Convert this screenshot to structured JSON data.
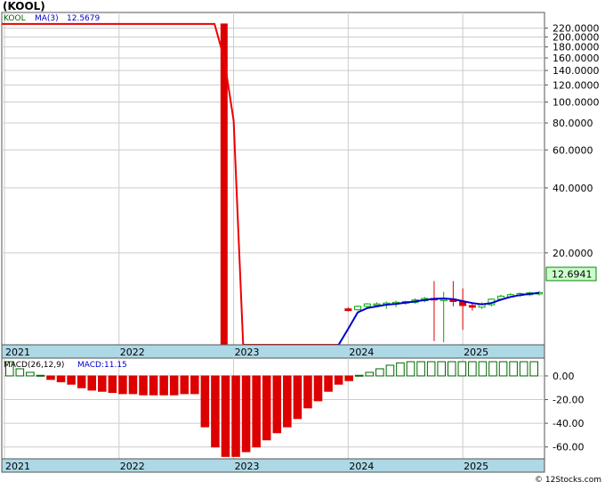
{
  "ticker_label": "(KOOL)",
  "legend": {
    "symbol": "KOOL",
    "ma_label": "MA(3)",
    "ma_value": "12.5679",
    "macd_label": "MACD(26,12,9)",
    "macd_name": "MACD:",
    "macd_value": "11.15"
  },
  "last_price": "12.6941",
  "footer": "© 12Stocks.com",
  "colors": {
    "up": "#00aa00",
    "down": "#dd0000",
    "ma": "#0000cc",
    "ma_red": "#ee0000",
    "axis_band": "#add8e6",
    "price_tag_bg": "#ccffcc"
  },
  "chart_data": [
    {
      "type": "candlestick",
      "title": "(KOOL)",
      "y_scale": "log",
      "y_ticks": [
        "220.0000",
        "200.0000",
        "180.0000",
        "160.0000",
        "140.0000",
        "120.0000",
        "100.0000",
        "80.0000",
        "60.0000",
        "40.0000",
        "20.0000"
      ],
      "y_tick_values": [
        220,
        200,
        180,
        160,
        140,
        120,
        100,
        80,
        60,
        40,
        20
      ],
      "x_ticks": [
        "2021",
        "2022",
        "2023",
        "2024",
        "2025"
      ],
      "x_tick_dates": [
        "2021-01",
        "2022-01",
        "2023-01",
        "2024-01",
        "2025-01"
      ],
      "ylim": [
        7.5,
        260
      ],
      "xlim": [
        "2021-01",
        "2025-09"
      ],
      "candles": [
        {
          "date": "2022-12",
          "open": 230,
          "high": 230,
          "low": 7.5,
          "close": 7.5,
          "dir": "down"
        },
        {
          "date": "2024-01",
          "open": 11.0,
          "high": 11.2,
          "low": 10.7,
          "close": 10.8,
          "dir": "down"
        },
        {
          "date": "2024-02",
          "open": 10.9,
          "high": 11.4,
          "low": 10.8,
          "close": 11.3,
          "dir": "up"
        },
        {
          "date": "2024-03",
          "open": 11.3,
          "high": 11.7,
          "low": 11.1,
          "close": 11.6,
          "dir": "up"
        },
        {
          "date": "2024-04",
          "open": 11.5,
          "high": 11.8,
          "low": 11.3,
          "close": 11.6,
          "dir": "up"
        },
        {
          "date": "2024-05",
          "open": 11.5,
          "high": 11.9,
          "low": 11.0,
          "close": 11.7,
          "dir": "up"
        },
        {
          "date": "2024-06",
          "open": 11.6,
          "high": 12.0,
          "low": 11.2,
          "close": 11.8,
          "dir": "up"
        },
        {
          "date": "2024-07",
          "open": 11.7,
          "high": 12.0,
          "low": 11.5,
          "close": 11.9,
          "dir": "up"
        },
        {
          "date": "2024-08",
          "open": 11.8,
          "high": 12.3,
          "low": 11.6,
          "close": 12.1,
          "dir": "up"
        },
        {
          "date": "2024-09",
          "open": 12.0,
          "high": 12.5,
          "low": 11.8,
          "close": 12.3,
          "dir": "up"
        },
        {
          "date": "2024-10",
          "open": 12.3,
          "high": 14.8,
          "low": 7.8,
          "close": 12.1,
          "dir": "down"
        },
        {
          "date": "2024-11",
          "open": 12.1,
          "high": 13.2,
          "low": 7.7,
          "close": 12.2,
          "dir": "up"
        },
        {
          "date": "2024-12",
          "open": 12.2,
          "high": 14.8,
          "low": 11.3,
          "close": 11.9,
          "dir": "down"
        },
        {
          "date": "2025-01",
          "open": 11.9,
          "high": 13.7,
          "low": 8.8,
          "close": 11.4,
          "dir": "down"
        },
        {
          "date": "2025-02",
          "open": 11.4,
          "high": 11.8,
          "low": 10.8,
          "close": 11.2,
          "dir": "down"
        },
        {
          "date": "2025-03",
          "open": 11.2,
          "high": 11.8,
          "low": 11.0,
          "close": 11.6,
          "dir": "up"
        },
        {
          "date": "2025-04",
          "open": 11.5,
          "high": 12.3,
          "low": 11.3,
          "close": 12.2,
          "dir": "up"
        },
        {
          "date": "2025-05",
          "open": 12.2,
          "high": 12.8,
          "low": 12.0,
          "close": 12.6,
          "dir": "up"
        },
        {
          "date": "2025-06",
          "open": 12.5,
          "high": 13.0,
          "low": 12.4,
          "close": 12.8,
          "dir": "up"
        },
        {
          "date": "2025-07",
          "open": 12.7,
          "high": 13.1,
          "low": 12.5,
          "close": 12.95,
          "dir": "up"
        },
        {
          "date": "2025-08",
          "open": 12.8,
          "high": 13.2,
          "low": 12.6,
          "close": 13.05,
          "dir": "up"
        },
        {
          "date": "2025-09",
          "open": 12.9,
          "high": 13.3,
          "low": 12.7,
          "close": 13.1,
          "dir": "up"
        }
      ],
      "ma_series": {
        "name": "MA(3)",
        "red_points": [
          {
            "date": "2021-01",
            "y": 230
          },
          {
            "date": "2022-11",
            "y": 230
          },
          {
            "date": "2022-12",
            "y": 160
          },
          {
            "date": "2023-01",
            "y": 82
          },
          {
            "date": "2023-02",
            "y": 7.5
          },
          {
            "date": "2023-12",
            "y": 7.5
          }
        ],
        "blue_points": [
          {
            "date": "2023-12",
            "y": 7.5
          },
          {
            "date": "2024-01",
            "y": 8.9
          },
          {
            "date": "2024-02",
            "y": 10.6
          },
          {
            "date": "2024-03",
            "y": 11.1
          },
          {
            "date": "2024-04",
            "y": 11.3
          },
          {
            "date": "2024-05",
            "y": 11.5
          },
          {
            "date": "2024-06",
            "y": 11.6
          },
          {
            "date": "2024-07",
            "y": 11.75
          },
          {
            "date": "2024-08",
            "y": 11.9
          },
          {
            "date": "2024-09",
            "y": 12.1
          },
          {
            "date": "2024-10",
            "y": 12.25
          },
          {
            "date": "2024-11",
            "y": 12.3
          },
          {
            "date": "2024-12",
            "y": 12.2
          },
          {
            "date": "2025-01",
            "y": 11.95
          },
          {
            "date": "2025-02",
            "y": 11.7
          },
          {
            "date": "2025-03",
            "y": 11.55
          },
          {
            "date": "2025-04",
            "y": 11.7
          },
          {
            "date": "2025-05",
            "y": 12.15
          },
          {
            "date": "2025-06",
            "y": 12.5
          },
          {
            "date": "2025-07",
            "y": 12.75
          },
          {
            "date": "2025-08",
            "y": 12.9
          },
          {
            "date": "2025-09",
            "y": 13.05
          }
        ]
      }
    },
    {
      "type": "bar",
      "title": "MACD(26,12,9)",
      "y_ticks": [
        "0.00",
        "-20.00",
        "-40.00",
        "-60.00"
      ],
      "y_tick_values": [
        0,
        -20,
        -40,
        -60
      ],
      "ylim": [
        -70,
        15
      ],
      "x_ticks": [
        "2021",
        "2022",
        "2023",
        "2024",
        "2025"
      ],
      "bars": [
        {
          "date": "2021-01",
          "value": 12
        },
        {
          "date": "2021-02",
          "value": 6
        },
        {
          "date": "2021-03",
          "value": 3
        },
        {
          "date": "2021-04",
          "value": 0.5
        },
        {
          "date": "2021-05",
          "value": -3
        },
        {
          "date": "2021-06",
          "value": -5
        },
        {
          "date": "2021-07",
          "value": -7
        },
        {
          "date": "2021-08",
          "value": -10
        },
        {
          "date": "2021-09",
          "value": -12
        },
        {
          "date": "2021-10",
          "value": -13
        },
        {
          "date": "2021-11",
          "value": -14
        },
        {
          "date": "2021-12",
          "value": -15
        },
        {
          "date": "2022-01",
          "value": -15
        },
        {
          "date": "2022-02",
          "value": -16
        },
        {
          "date": "2022-03",
          "value": -16
        },
        {
          "date": "2022-04",
          "value": -16
        },
        {
          "date": "2022-05",
          "value": -16
        },
        {
          "date": "2022-06",
          "value": -15
        },
        {
          "date": "2022-07",
          "value": -15
        },
        {
          "date": "2022-08",
          "value": -43
        },
        {
          "date": "2022-09",
          "value": -60
        },
        {
          "date": "2022-10",
          "value": -68
        },
        {
          "date": "2022-11",
          "value": -68
        },
        {
          "date": "2022-12",
          "value": -64
        },
        {
          "date": "2023-01",
          "value": -60
        },
        {
          "date": "2023-02",
          "value": -54
        },
        {
          "date": "2023-03",
          "value": -48
        },
        {
          "date": "2023-04",
          "value": -43
        },
        {
          "date": "2023-05",
          "value": -36
        },
        {
          "date": "2023-06",
          "value": -27
        },
        {
          "date": "2023-07",
          "value": -21
        },
        {
          "date": "2023-08",
          "value": -13
        },
        {
          "date": "2023-09",
          "value": -7
        },
        {
          "date": "2023-10",
          "value": -4
        },
        {
          "date": "2023-11",
          "value": 0.5
        },
        {
          "date": "2023-12",
          "value": 3
        },
        {
          "date": "2024-01",
          "value": 6
        },
        {
          "date": "2024-02",
          "value": 9
        },
        {
          "date": "2024-03",
          "value": 11
        },
        {
          "date": "2024-04",
          "value": 12
        },
        {
          "date": "2024-05",
          "value": 12
        },
        {
          "date": "2024-06",
          "value": 12
        },
        {
          "date": "2024-07",
          "value": 12
        },
        {
          "date": "2024-08",
          "value": 12
        },
        {
          "date": "2024-09",
          "value": 12
        },
        {
          "date": "2024-10",
          "value": 12
        },
        {
          "date": "2024-11",
          "value": 12
        },
        {
          "date": "2024-12",
          "value": 12
        },
        {
          "date": "2025-01",
          "value": 12
        },
        {
          "date": "2025-02",
          "value": 12
        },
        {
          "date": "2025-03",
          "value": 12
        },
        {
          "date": "2025-04",
          "value": 12
        }
      ]
    }
  ]
}
